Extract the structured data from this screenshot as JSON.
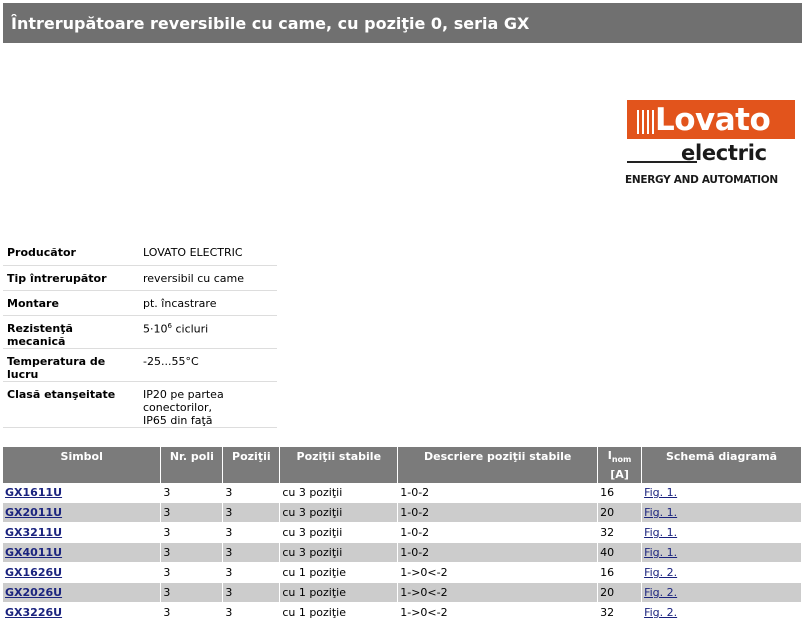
{
  "header": {
    "title": "Întrerupătoare reversibile cu came, cu poziţie 0, seria GX"
  },
  "logo": {
    "word": "Lovato",
    "sub": "electric",
    "tagline": "ENERGY AND AUTOMATION",
    "brand_color": "#e2541c"
  },
  "specs": [
    {
      "key": "Producător",
      "value": "LOVATO ELECTRIC"
    },
    {
      "key": "Tip întrerupător",
      "value": "reversibil cu came"
    },
    {
      "key": "Montare",
      "value": "pt. încastrare"
    },
    {
      "key": "Rezistenţă mecanică",
      "value_base": "5·10",
      "value_exp": "6",
      "value_rest": " cicluri"
    },
    {
      "key": "Temperatura de lucru",
      "value": "-25...55°C"
    },
    {
      "key": "Clasă etanşeitate",
      "value_line1": "IP20 pe partea conectorilor,",
      "value_line2": "IP65 din faţă"
    }
  ],
  "table": {
    "headers": [
      "Simbol",
      "Nr. poli",
      "Poziţii",
      "Poziţii stabile",
      "Descriere poziţii stabile",
      "I",
      "Schemă diagramă"
    ],
    "inom_sub": "nom",
    "inom_unit": "[A]",
    "rows": [
      {
        "symbol": "GX1611U",
        "poles": "3",
        "positions": "3",
        "stable": "cu 3 poziţii",
        "desc": "1-0-2",
        "inom": "16",
        "fig": "Fig. 1."
      },
      {
        "symbol": "GX2011U",
        "poles": "3",
        "positions": "3",
        "stable": "cu 3 poziţii",
        "desc": "1-0-2",
        "inom": "20",
        "fig": "Fig. 1."
      },
      {
        "symbol": "GX3211U",
        "poles": "3",
        "positions": "3",
        "stable": "cu 3 poziţii",
        "desc": "1-0-2",
        "inom": "32",
        "fig": "Fig. 1."
      },
      {
        "symbol": "GX4011U",
        "poles": "3",
        "positions": "3",
        "stable": "cu 3 poziţii",
        "desc": "1-0-2",
        "inom": "40",
        "fig": "Fig. 1."
      },
      {
        "symbol": "GX1626U",
        "poles": "3",
        "positions": "3",
        "stable": "cu 1 poziţie",
        "desc": "1->0<-2",
        "inom": "16",
        "fig": "Fig. 2."
      },
      {
        "symbol": "GX2026U",
        "poles": "3",
        "positions": "3",
        "stable": "cu 1 poziţie",
        "desc": "1->0<-2",
        "inom": "20",
        "fig": "Fig. 2."
      },
      {
        "symbol": "GX3226U",
        "poles": "3",
        "positions": "3",
        "stable": "cu 1 poziţie",
        "desc": "1->0<-2",
        "inom": "32",
        "fig": "Fig. 2."
      }
    ]
  }
}
